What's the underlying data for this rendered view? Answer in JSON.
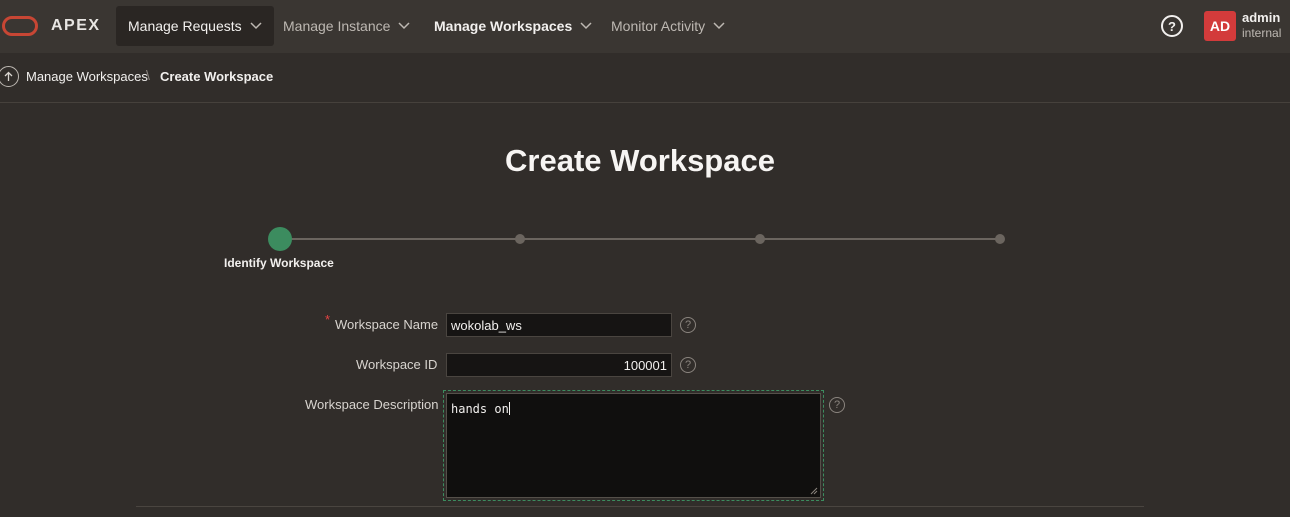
{
  "header": {
    "brand": "APEX",
    "nav": [
      {
        "label": "Manage Requests"
      },
      {
        "label": "Manage Instance"
      },
      {
        "label": "Manage Workspaces"
      },
      {
        "label": "Monitor Activity"
      }
    ],
    "help_glyph": "?",
    "user": {
      "initials": "AD",
      "name": "admin",
      "workspace": "internal"
    }
  },
  "breadcrumb": {
    "items": [
      "Manage Workspaces",
      "Create Workspace"
    ],
    "separator": "\\"
  },
  "page": {
    "title": "Create Workspace"
  },
  "wizard": {
    "current_step_label": "Identify Workspace",
    "step_count": 4,
    "current_step": 1
  },
  "form": {
    "required_marker": "*",
    "workspace_name": {
      "label": "Workspace Name",
      "value": "wokolab_ws"
    },
    "workspace_id": {
      "label": "Workspace ID",
      "value": "100001"
    },
    "workspace_description": {
      "label": "Workspace Description",
      "value": "hands on"
    },
    "help_glyph": "?"
  },
  "colors": {
    "accent_green": "#3c8c5f",
    "brand_red": "#c74634",
    "avatar_red": "#d33b3b"
  }
}
